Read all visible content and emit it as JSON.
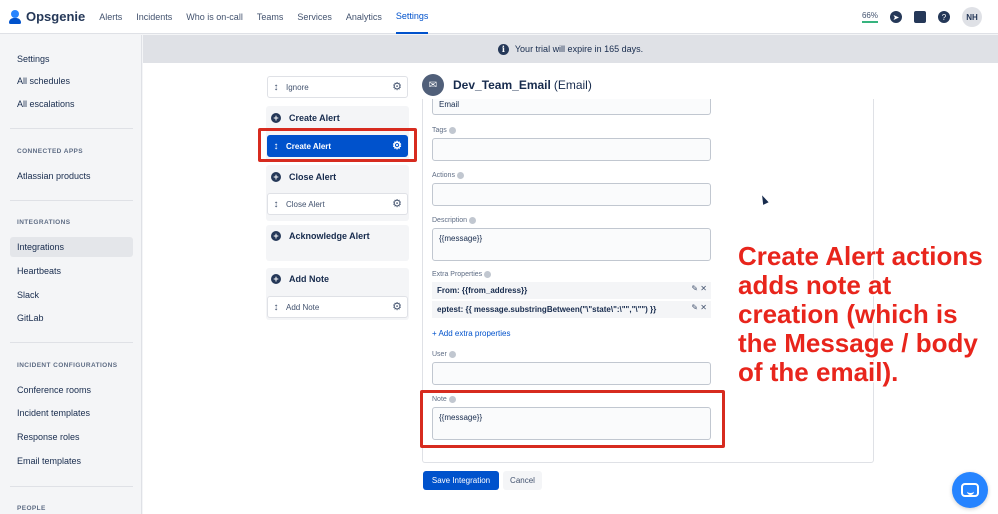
{
  "app": {
    "name": "Opsgenie",
    "brand_color": "#0052CC"
  },
  "nav": {
    "items": [
      "Alerts",
      "Incidents",
      "Who is on-call",
      "Teams",
      "Services",
      "Analytics",
      "Settings"
    ],
    "active": "Settings",
    "usage_pct": "66%",
    "avatar_initials": "NH"
  },
  "sidebar": {
    "title": "Settings",
    "top_items": [
      "All schedules",
      "All escalations"
    ],
    "sections": [
      {
        "label": "CONNECTED APPS",
        "items": [
          "Atlassian products"
        ]
      },
      {
        "label": "INTEGRATIONS",
        "items": [
          "Integrations",
          "Heartbeats",
          "Slack",
          "GitLab"
        ]
      },
      {
        "label": "INCIDENT CONFIGURATIONS",
        "items": [
          "Conference rooms",
          "Incident templates",
          "Response roles",
          "Email templates"
        ]
      },
      {
        "label": "PEOPLE",
        "items": []
      }
    ],
    "active_item": "Integrations"
  },
  "banner": {
    "text": "Your trial will expire in 165 days."
  },
  "actions": {
    "ignore_row": "Ignore",
    "groups": [
      {
        "header": "Create Alert",
        "row": "Create Alert"
      },
      {
        "header": "Close Alert",
        "row": "Close Alert"
      },
      {
        "header": "Acknowledge Alert",
        "row": ""
      },
      {
        "header": "Add Note",
        "row": "Add Note"
      }
    ],
    "selected": "Create Alert"
  },
  "form": {
    "integration_name": "Dev_Team_Email",
    "integration_type": "(Email)",
    "partial_field_value": "Email",
    "tags": {
      "label": "Tags",
      "value": ""
    },
    "actions_field": {
      "label": "Actions",
      "value": ""
    },
    "description": {
      "label": "Description",
      "value": "{{message}}"
    },
    "extra_properties": {
      "label": "Extra Properties",
      "rows": [
        "From: {{from_address}}",
        "eptest: {{ message.substringBetween(\"\\\"state\\\":\\\"\",\"\\\"\") }}"
      ],
      "add_link": "+ Add extra properties"
    },
    "user": {
      "label": "User",
      "value": ""
    },
    "note": {
      "label": "Note",
      "value": "{{message}}"
    },
    "save_label": "Save Integration",
    "cancel_label": "Cancel"
  },
  "annotation": {
    "text": "Create Alert actions adds note at creation (which is the Message / body of the email).",
    "color": "#E8251C"
  }
}
